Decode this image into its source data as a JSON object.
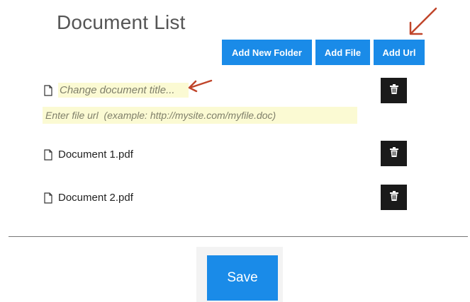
{
  "page": {
    "title": "Document List"
  },
  "toolbar": {
    "add_folder_label": "Add New Folder",
    "add_file_label": "Add File",
    "add_url_label": "Add Url"
  },
  "new_item": {
    "title_placeholder": "Change document title...",
    "url_placeholder": "Enter file url  (example: http://mysite.com/myfile.doc)"
  },
  "documents": [
    {
      "name": "Document 1.pdf"
    },
    {
      "name": "Document 2.pdf"
    }
  ],
  "footer": {
    "save_label": "Save"
  },
  "icons": {
    "file": "file-icon",
    "trash": "trash-icon",
    "annotation_arrow": "arrow-icon"
  },
  "colors": {
    "primary": "#1a8be8",
    "danger_bg": "#1a1a1a",
    "input_highlight": "#fbfad3",
    "annotation_arrow": "#c0452a"
  }
}
